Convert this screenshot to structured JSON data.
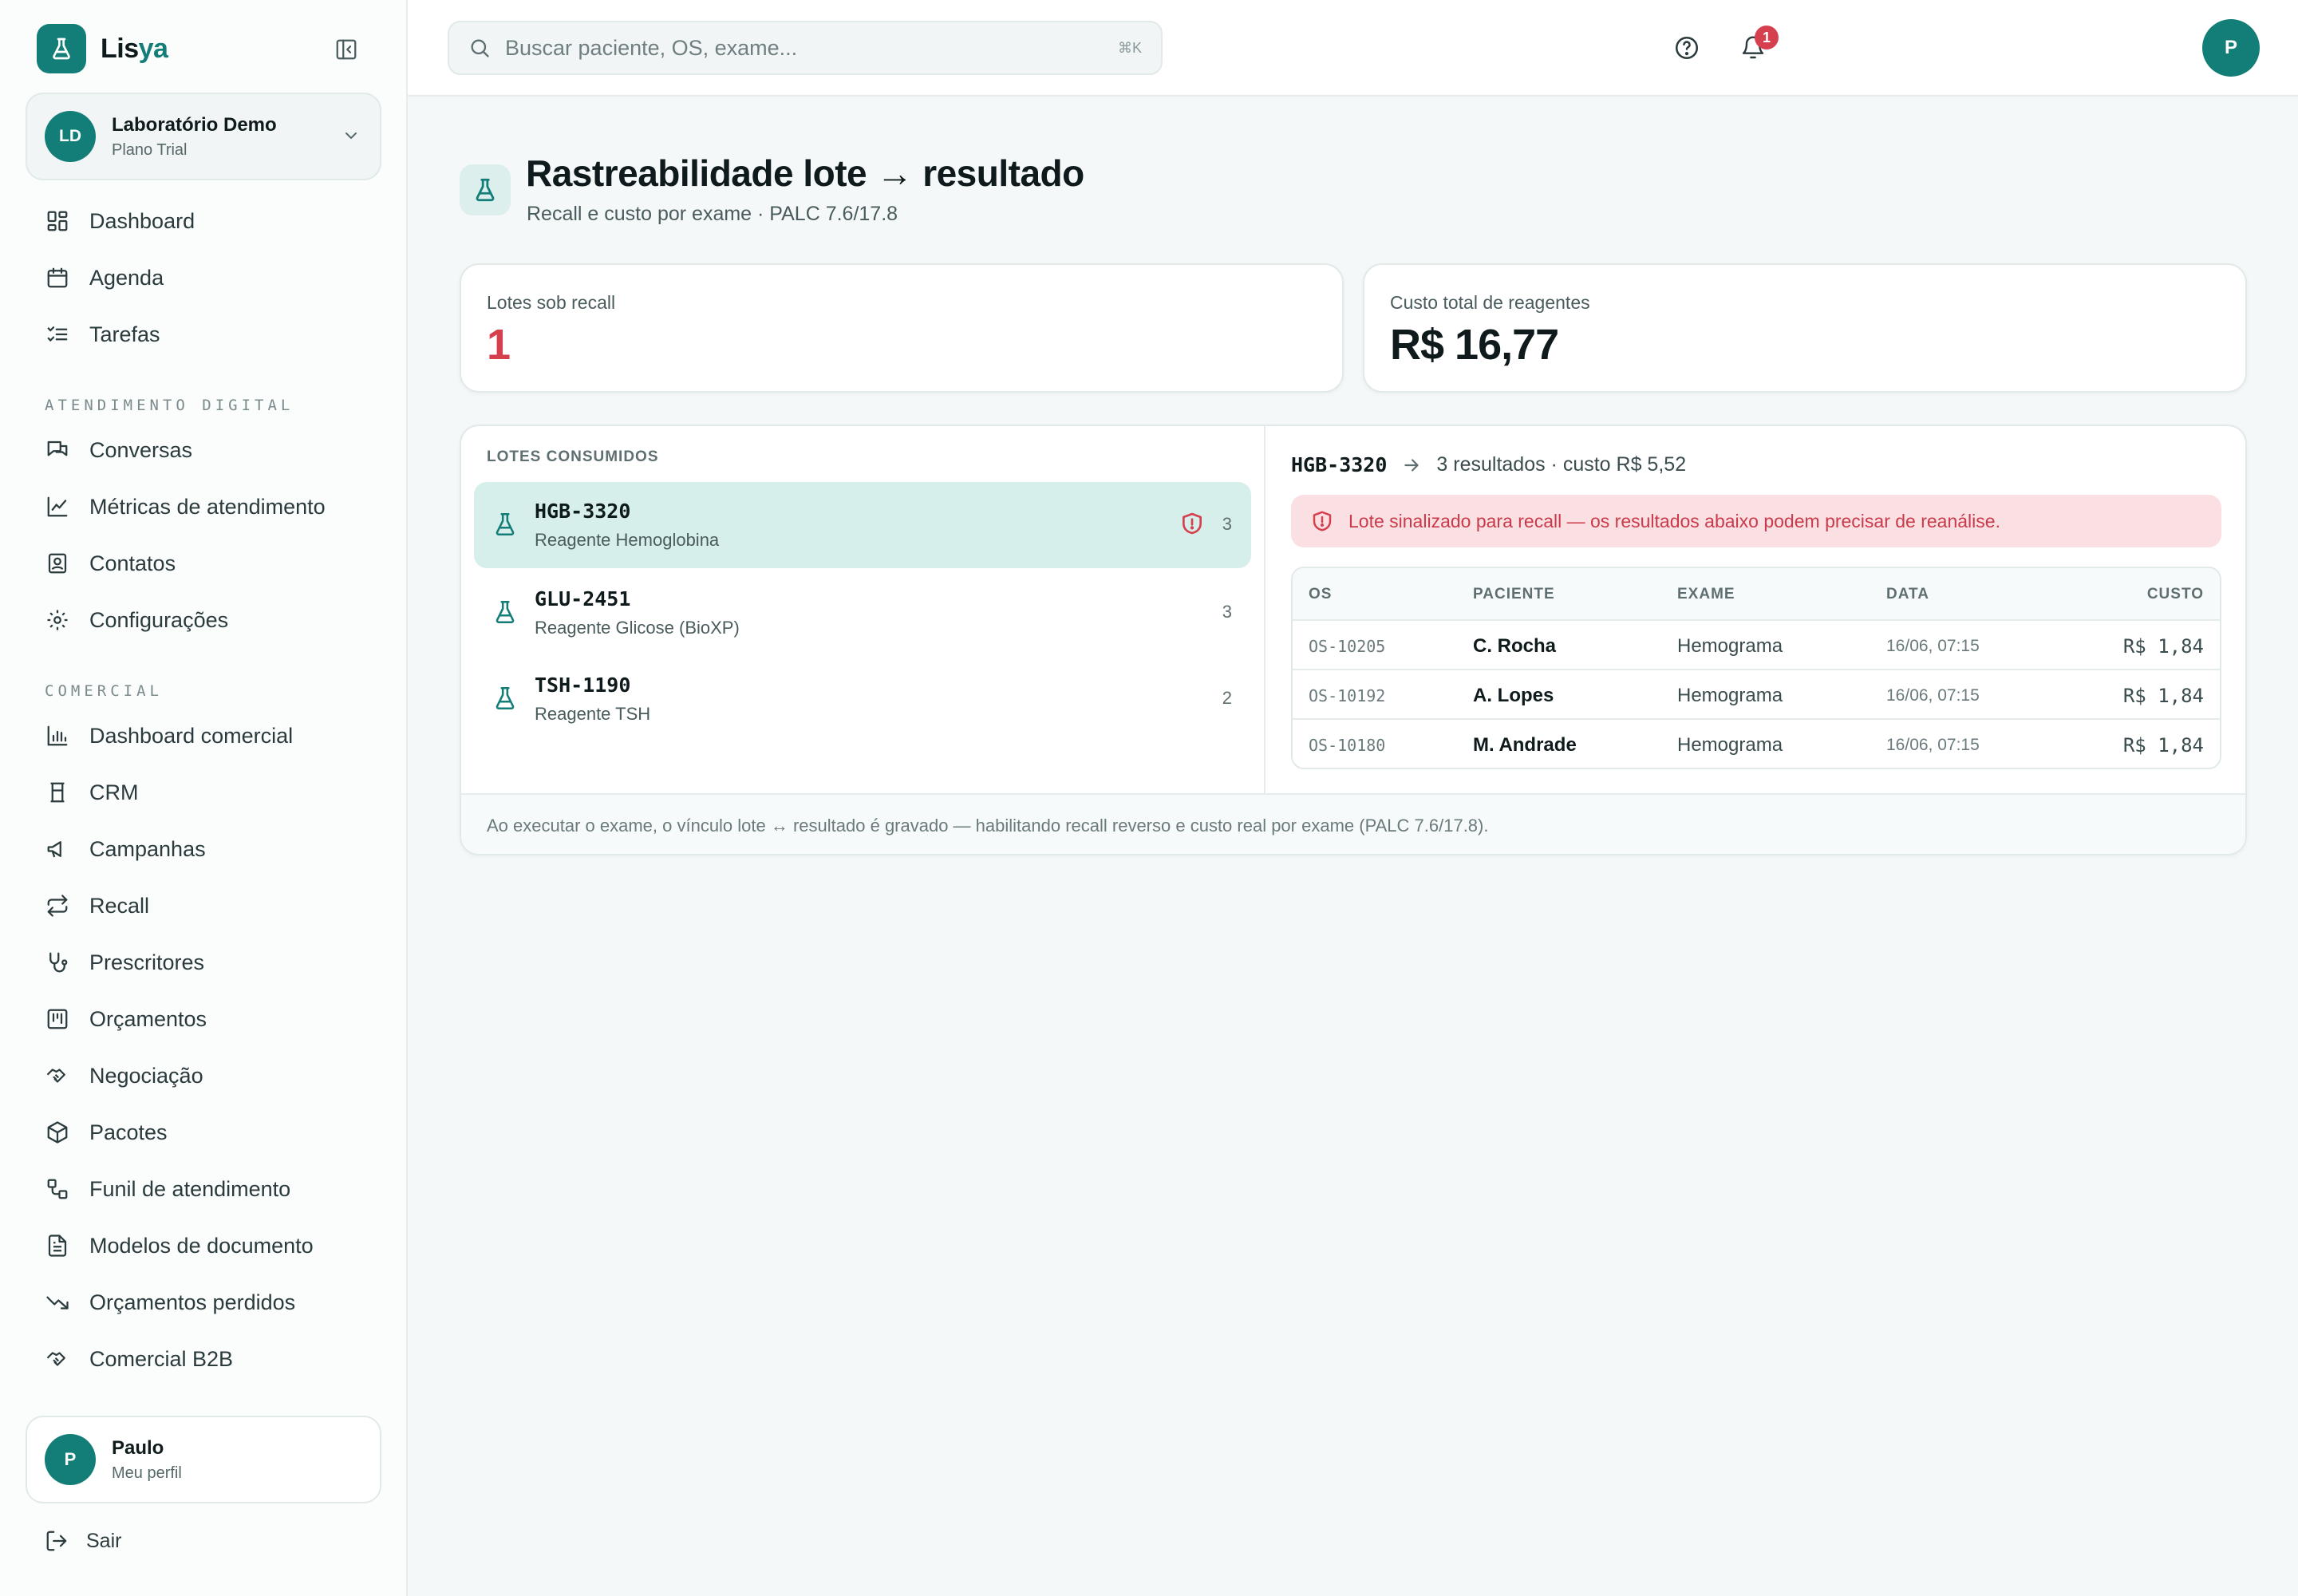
{
  "colors": {
    "brand": "#137d78",
    "danger": "#d6404e",
    "active_bg": "#d7efeb"
  },
  "brand": {
    "name_part1": "Lis",
    "name_part2": "ya"
  },
  "org": {
    "initials": "LD",
    "name": "Laboratório Demo",
    "plan": "Plano Trial"
  },
  "sidebar": {
    "main_items": [
      {
        "label": "Dashboard",
        "icon": "dashboard-icon"
      },
      {
        "label": "Agenda",
        "icon": "calendar-icon"
      },
      {
        "label": "Tarefas",
        "icon": "tasks-icon"
      }
    ],
    "section_atendimento": "ATENDIMENTO DIGITAL",
    "atendimento_items": [
      {
        "label": "Conversas",
        "icon": "chat-icon"
      },
      {
        "label": "Métricas de atendimento",
        "icon": "line-chart-icon"
      },
      {
        "label": "Contatos",
        "icon": "contacts-icon"
      },
      {
        "label": "Configurações",
        "icon": "gear-icon"
      }
    ],
    "section_comercial": "COMERCIAL",
    "comercial_items": [
      {
        "label": "Dashboard comercial",
        "icon": "bar-chart-icon"
      },
      {
        "label": "CRM",
        "icon": "crm-icon"
      },
      {
        "label": "Campanhas",
        "icon": "megaphone-icon"
      },
      {
        "label": "Recall",
        "icon": "repeat-icon"
      },
      {
        "label": "Prescritores",
        "icon": "stethoscope-icon"
      },
      {
        "label": "Orçamentos",
        "icon": "kanban-icon"
      },
      {
        "label": "Negociação",
        "icon": "handshake-icon"
      },
      {
        "label": "Pacotes",
        "icon": "package-icon"
      },
      {
        "label": "Funil de atendimento",
        "icon": "workflow-icon"
      },
      {
        "label": "Modelos de documento",
        "icon": "document-icon"
      },
      {
        "label": "Orçamentos perdidos",
        "icon": "trending-down-icon"
      },
      {
        "label": "Comercial B2B",
        "icon": "handshake-icon"
      }
    ],
    "profile": {
      "initial": "P",
      "name": "Paulo",
      "sub": "Meu perfil"
    },
    "logout": "Sair"
  },
  "topbar": {
    "search_placeholder": "Buscar paciente, OS, exame...",
    "search_kbd": "⌘K",
    "notification_count": "1",
    "user_initial": "P"
  },
  "page": {
    "title": "Rastreabilidade lote → resultado",
    "subtitle": "Recall e custo por exame · PALC 7.6/17.8"
  },
  "kpis": {
    "recall_label": "Lotes sob recall",
    "recall_value": "1",
    "cost_label": "Custo total de reagentes",
    "cost_value": "R$ 16,77"
  },
  "lots": {
    "title": "LOTES CONSUMIDOS",
    "items": [
      {
        "code": "HGB-3320",
        "name": "Reagente Hemoglobina",
        "count": "3",
        "recall": true,
        "active": true
      },
      {
        "code": "GLU-2451",
        "name": "Reagente Glicose (BioXP)",
        "count": "3",
        "recall": false,
        "active": false
      },
      {
        "code": "TSH-1190",
        "name": "Reagente TSH",
        "count": "2",
        "recall": false,
        "active": false
      }
    ]
  },
  "detail": {
    "code": "HGB-3320",
    "info": "3 resultados · custo R$ 5,52",
    "alert": "Lote sinalizado para recall — os resultados abaixo podem precisar de reanálise.",
    "columns": {
      "os": "OS",
      "paciente": "PACIENTE",
      "exame": "EXAME",
      "data": "DATA",
      "custo": "CUSTO"
    },
    "rows": [
      {
        "os": "OS-10205",
        "paciente": "C. Rocha",
        "exame": "Hemograma",
        "data": "16/06, 07:15",
        "custo": "R$ 1,84"
      },
      {
        "os": "OS-10192",
        "paciente": "A. Lopes",
        "exame": "Hemograma",
        "data": "16/06, 07:15",
        "custo": "R$ 1,84"
      },
      {
        "os": "OS-10180",
        "paciente": "M. Andrade",
        "exame": "Hemograma",
        "data": "16/06, 07:15",
        "custo": "R$ 1,84"
      }
    ]
  },
  "footer_note": "Ao executar o exame, o vínculo lote ↔ resultado é gravado — habilitando recall reverso e custo real por exame (PALC 7.6/17.8)."
}
